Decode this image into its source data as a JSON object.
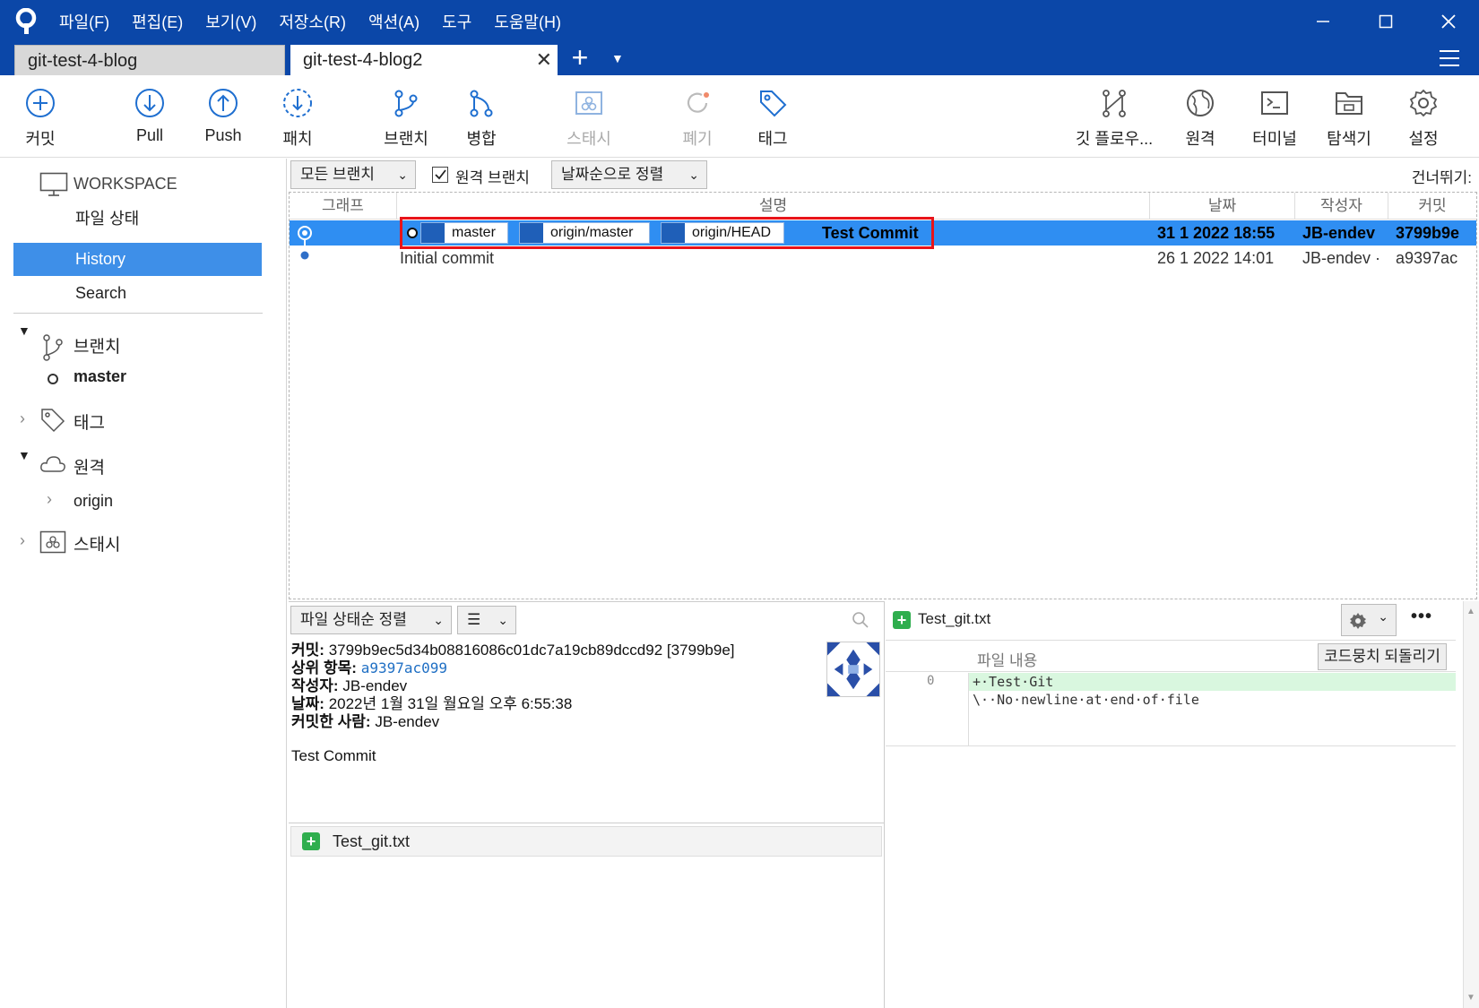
{
  "menu": [
    "파일(F)",
    "편집(E)",
    "보기(V)",
    "저장소(R)",
    "액션(A)",
    "도구",
    "도움말(H)"
  ],
  "tabs": [
    {
      "label": "git-test-4-blog",
      "active": false
    },
    {
      "label": "git-test-4-blog2",
      "active": true
    }
  ],
  "toolbar": {
    "commit": "커밋",
    "pull": "Pull",
    "push": "Push",
    "patch": "패치",
    "branch": "브랜치",
    "merge": "병합",
    "stash": "스태시",
    "discard": "폐기",
    "tag": "태그",
    "gitflow": "깃 플로우...",
    "remote": "원격",
    "terminal": "터미널",
    "explorer": "탐색기",
    "settings": "설정"
  },
  "sidebar": {
    "workspace": "WORKSPACE",
    "file_status": "파일 상태",
    "history": "History",
    "search": "Search",
    "branches": "브랜치",
    "branch_items": [
      "master"
    ],
    "tags": "태그",
    "remotes": "원격",
    "remote_items": [
      "origin"
    ],
    "stashes": "스태시"
  },
  "history": {
    "branch_filter": "모든 브랜치",
    "show_remote_label": "원격 브랜치",
    "show_remote_checked": true,
    "sort": "날짜순으로 정렬",
    "jump_label": "건너뛰기:",
    "columns": {
      "graph": "그래프",
      "desc": "설명",
      "date": "날짜",
      "author": "작성자",
      "commit": "커밋"
    },
    "rows": [
      {
        "badges": [
          "master",
          "origin/master",
          "origin/HEAD"
        ],
        "message": "Test Commit",
        "date": "31 1 2022 18:55",
        "author": "JB-endev",
        "hash": "3799b9e",
        "selected": true
      },
      {
        "badges": [],
        "message": "Initial commit",
        "date": "26 1 2022 14:01",
        "author": "JB-endev ·",
        "hash": "a9397ac",
        "selected": false
      }
    ]
  },
  "details": {
    "sort": "파일 상태순 정렬",
    "commit_label": "커밋:",
    "commit_value": "3799b9ec5d34b08816086c01dc7a19cb89dccd92 [3799b9e]",
    "parent_label": "상위 항목:",
    "parent_value": "a9397ac099",
    "author_label": "작성자:",
    "author_value": "JB-endev",
    "date_label": "날짜:",
    "date_value": "2022년 1월 31일 월요일 오후 6:55:38",
    "committer_label": "커밋한 사람:",
    "committer_value": "JB-endev",
    "message": "Test Commit",
    "files": [
      "Test_git.txt"
    ]
  },
  "diff": {
    "file": "Test_git.txt",
    "content_label": "파일 내용",
    "revert_button": "코드뭉치 되돌리기",
    "line_no": "0",
    "added_line": "+·Test·Git",
    "note_line": "\\··No·newline·at·end·of·file"
  },
  "colors": {
    "title_bar": "#0b47a8",
    "selection": "#2f8ef2",
    "sidebar_selection": "#3e8fe8",
    "highlight_box": "#e8141a",
    "added": "#2fae4e"
  }
}
